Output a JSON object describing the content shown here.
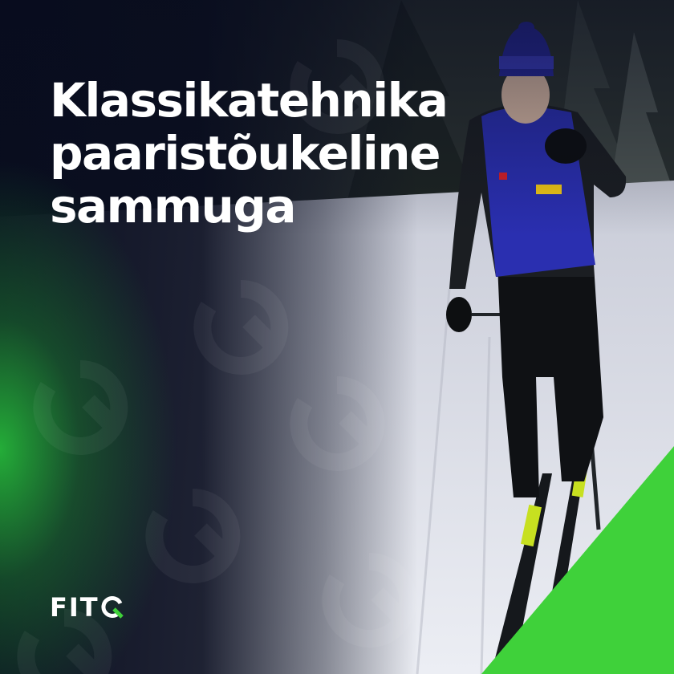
{
  "headline": {
    "line1": "Klassikatehnika",
    "line2": "paaristõukeline",
    "line3": "sammuga"
  },
  "logo": {
    "text": "FIT"
  },
  "colors": {
    "brand_green": "#3fd13a",
    "dark_navy": "#0a1022",
    "vest_blue": "#2a2fb0",
    "snow": "#e8e9f0"
  },
  "icons": {
    "logo_mark": "q-letter-icon",
    "pattern": "q-pattern-icon"
  }
}
